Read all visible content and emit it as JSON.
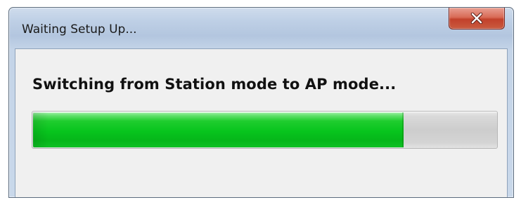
{
  "window": {
    "title": "Waiting Setup Up...",
    "close_icon": "close-x-icon"
  },
  "dialog": {
    "message": "Switching from Station mode to AP mode...",
    "progress": {
      "fraction": 0.8,
      "fill_color": "#06c41d",
      "track_color": "#cdcdcd"
    }
  }
}
